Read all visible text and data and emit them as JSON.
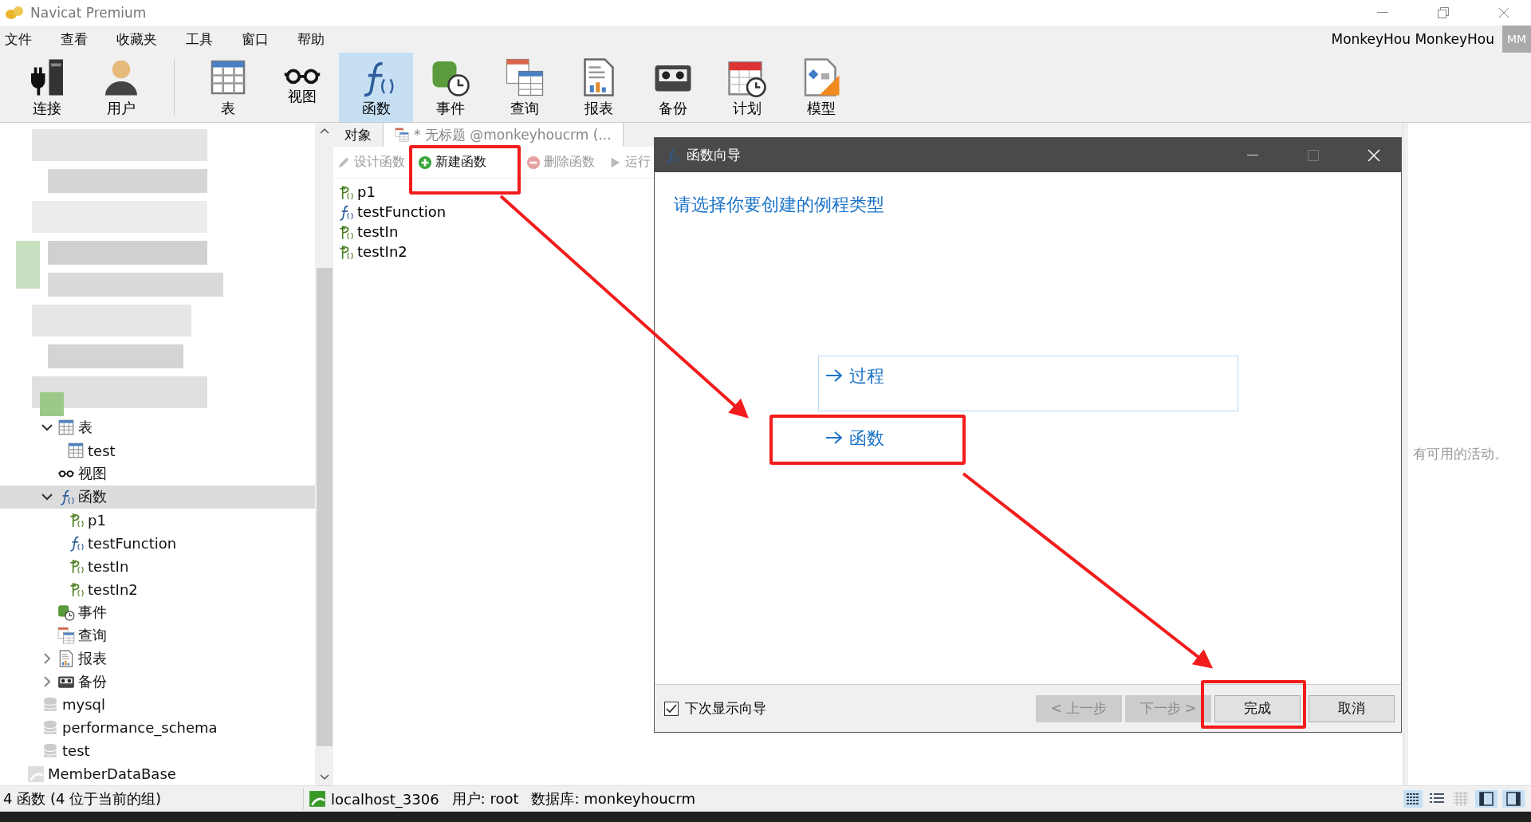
{
  "window": {
    "title": "Navicat Premium"
  },
  "menu": [
    "文件",
    "查看",
    "收藏夹",
    "工具",
    "窗口",
    "帮助"
  ],
  "user": {
    "name": "MonkeyHou MonkeyHou",
    "initials": "MM"
  },
  "toolbar": [
    {
      "kind": "connect",
      "label": "连接",
      "selected": false
    },
    {
      "kind": "user",
      "label": "用户",
      "selected": false
    },
    {
      "kind": "table",
      "label": "表",
      "selected": false
    },
    {
      "kind": "view",
      "label": "视图",
      "selected": false
    },
    {
      "kind": "function",
      "label": "函数",
      "selected": true
    },
    {
      "kind": "event",
      "label": "事件",
      "selected": false
    },
    {
      "kind": "query",
      "label": "查询",
      "selected": false
    },
    {
      "kind": "report",
      "label": "报表",
      "selected": false
    },
    {
      "kind": "backup",
      "label": "备份",
      "selected": false
    },
    {
      "kind": "schedule",
      "label": "计划",
      "selected": false
    },
    {
      "kind": "model",
      "label": "模型",
      "selected": false
    }
  ],
  "tree": {
    "categories": [
      {
        "kind": "table",
        "label": "表",
        "expanded": true,
        "selected": false,
        "children": [
          {
            "kind": "table",
            "label": "test"
          }
        ]
      },
      {
        "kind": "view",
        "label": "视图",
        "selected": false
      },
      {
        "kind": "function",
        "label": "函数",
        "expanded": true,
        "selected": true,
        "children": [
          {
            "kind": "procedure",
            "label": "p1"
          },
          {
            "kind": "function",
            "label": "testFunction"
          },
          {
            "kind": "procedure",
            "label": "testIn"
          },
          {
            "kind": "procedure",
            "label": "testIn2"
          }
        ]
      },
      {
        "kind": "event",
        "label": "事件",
        "selected": false
      },
      {
        "kind": "query",
        "label": "查询",
        "selected": false
      },
      {
        "kind": "report",
        "label": "报表",
        "expanded": false,
        "selected": false
      },
      {
        "kind": "backup",
        "label": "备份",
        "expanded": false,
        "selected": false
      }
    ],
    "databases": [
      "mysql",
      "performance_schema",
      "test"
    ],
    "connections": [
      "MemberDataBase"
    ]
  },
  "tabs": [
    {
      "kind": "objects",
      "label": "对象",
      "selected": true
    },
    {
      "kind": "query",
      "label": "* 无标题 @monkeyhoucrm (...",
      "selected": false
    }
  ],
  "object_toolbar": [
    {
      "kind": "design",
      "label": "设计函数",
      "disabled": true
    },
    {
      "kind": "new",
      "label": "新建函数",
      "disabled": false
    },
    {
      "kind": "delete",
      "label": "删除函数",
      "disabled": true
    },
    {
      "kind": "run",
      "label": "运行",
      "disabled": true
    }
  ],
  "objects": [
    {
      "kind": "procedure",
      "label": "p1"
    },
    {
      "kind": "function",
      "label": "testFunction"
    },
    {
      "kind": "procedure",
      "label": "testIn"
    },
    {
      "kind": "procedure",
      "label": "testIn2"
    }
  ],
  "activity": {
    "message": "有可用的活动。"
  },
  "dialog": {
    "title": "函数向导",
    "heading": "请选择你要创建的例程类型",
    "options": [
      {
        "label": "过程",
        "selected": true
      },
      {
        "label": "函数",
        "selected": false
      }
    ],
    "show_next_time": {
      "label": "下次显示向导",
      "checked": true
    },
    "buttons": [
      {
        "label": "< 上一步",
        "disabled": true
      },
      {
        "label": "下一步 >",
        "disabled": true
      },
      {
        "label": "完成",
        "disabled": false
      },
      {
        "label": "取消",
        "disabled": false
      }
    ]
  },
  "status_bar": {
    "summary": "4 函数 (4 位于当前的组)",
    "connection": "localhost_3306",
    "user": "用户: root",
    "database": "数据库: monkeyhoucrm"
  }
}
